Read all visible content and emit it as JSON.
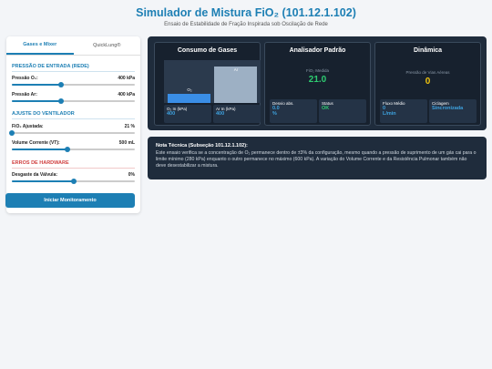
{
  "header": {
    "title": "Simulador de Mistura FiO₂ (101.12.1.102)",
    "subtitle": "Ensaio de Estabilidade de Fração Inspirada sob Oscilação de Rede"
  },
  "tabs": [
    {
      "label": "Gases e Mixer",
      "active": true
    },
    {
      "label": "QuickLung®",
      "active": false
    }
  ],
  "sections": {
    "pressure": "Pressão de Entrada (Rede)",
    "ventilator": "Ajuste do Ventilador",
    "hardware": "Erros de Hardware"
  },
  "controls": {
    "o2_pressure": {
      "label": "Pressão O₂:",
      "value": "400 kPa",
      "level": 0.4
    },
    "air_pressure": {
      "label": "Pressão Ar:",
      "value": "400 kPa",
      "level": 0.4
    },
    "fio2": {
      "label": "FiO₂ Ajustada:",
      "value": "21 %",
      "level": 0.0
    },
    "tidal_volume": {
      "label": "Volume Corrente (VT):",
      "value": "500 mL",
      "level": 0.45
    },
    "valve_wear": {
      "label": "Desgaste da Válvula:",
      "value": "0%",
      "level": 0.5
    }
  },
  "start_button": "Iniciar Monitoramento",
  "gas_card": {
    "title": "Consumo de Gases",
    "o2_bar_label": "O₂",
    "air_bar_label": "Ar",
    "o2_bar_level": 0.22,
    "air_bar_level": 0.85,
    "o2_in_label": "O₂ In (kPa)",
    "o2_in_value": "400",
    "air_in_label": "Ar In (kPa)",
    "air_in_value": "400"
  },
  "analyzer_card": {
    "title": "Analisador Padrão",
    "measured_label": "FiO₂ Medida",
    "measured_value": "21.0",
    "deviation_label": "Desvio abs.",
    "deviation_value": "0.0",
    "deviation_unit": "%",
    "status_label": "Status",
    "status_value": "OK"
  },
  "dynamics_card": {
    "title": "Dinâmica",
    "airway_pressure_label": "Pressão de Vias Aéreas",
    "airway_pressure_value": "0",
    "flow_label": "Fluxo Médio",
    "flow_value": "0",
    "flow_unit": "L/min",
    "cycling_label": "Ciclagem",
    "cycling_value": "Sincronizada"
  },
  "note": {
    "title": "Nota Técnica (Subseção 101.12.1.102):",
    "text": "Este ensaio verifica se a concentração de O₂ permanece dentro de ±3% da configuração, mesmo quando a pressão de suprimento de um gás cai para o limite mínimo (280 kPa) enquanto o outro permanece no máximo (600 kPa). A variação do Volume Corrente e da Resistência Pulmonar também não deve desestabilizar a mistura."
  },
  "colors": {
    "accent": "#1d7fb4",
    "danger": "#d04040",
    "dashboard_bg": "#1f2c3c",
    "value_blue": "#3ea3e0",
    "value_green": "#2ecc71",
    "value_yellow": "#f1c40f",
    "o2_bar": "#3a8ee6",
    "air_bar": "#9db0c4"
  }
}
